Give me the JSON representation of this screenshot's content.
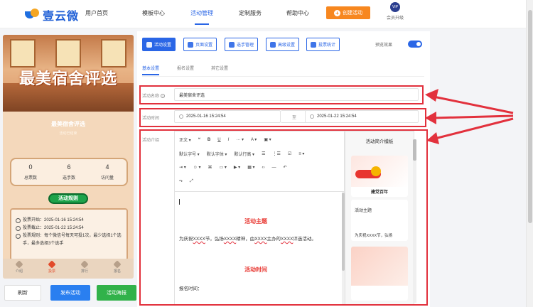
{
  "brand": {
    "name": "壹云微"
  },
  "nav": [
    {
      "label": "用户首页"
    },
    {
      "label": "模板中心"
    },
    {
      "label": "活动管理"
    },
    {
      "label": "定制服务"
    },
    {
      "label": "帮助中心"
    }
  ],
  "create_button": "创建活动",
  "vip": {
    "badge": "VIP",
    "label": "会员升级"
  },
  "preview": {
    "banner_title": "最美宿舍评选",
    "subtitle": "最美宿舍评选",
    "subtitle2": "活动已结束",
    "stats": [
      {
        "value": "0",
        "label": "总票数"
      },
      {
        "value": "6",
        "label": "选手数"
      },
      {
        "value": "4",
        "label": "访问量"
      }
    ],
    "rules_button": "活动规则",
    "rules": [
      "投票开始：2025-01-16 15:24:54",
      "投票截止：2025-01-22 15:24:54",
      "投票规则：每个微信号每天可投1次，最少选择1个选手，最多选择3个选手"
    ],
    "tabs": [
      "介绍",
      "投票",
      "排行",
      "报名"
    ]
  },
  "bottom_buttons": {
    "refresh": "刷新",
    "publish": "发布活动",
    "poster": "活动海报"
  },
  "toolbar": [
    {
      "label": "活动设置"
    },
    {
      "label": "页面设置"
    },
    {
      "label": "选手管理"
    },
    {
      "label": "高级设置"
    },
    {
      "label": "投票统计"
    }
  ],
  "preview_toggle_label": "预览效果",
  "subtabs": [
    "基本设置",
    "报名设置",
    "其它设置"
  ],
  "form": {
    "name_label": "活动名称",
    "name_value": "最美宿舍评选",
    "time_label": "活动时间",
    "start": "2025-01-16 15:24:54",
    "to": "至",
    "end": "2025-01-22 15:24:54",
    "intro_label": "活动介绍"
  },
  "editor": {
    "row1": [
      "正文 ▾",
      "❝",
      "B",
      "U",
      "I",
      "··· ▾",
      "A ▾",
      "▣ ▾"
    ],
    "row2": [
      "默认字号 ▾",
      "默认字体 ▾",
      "默认行高 ▾",
      "☰",
      "⋮☰",
      "☑",
      "≡ ▾"
    ],
    "row3": [
      "⇥ ▾",
      "☺ ▾",
      "⌘",
      "▭ ▾",
      "▶ ▾",
      "▦ ▾",
      "‹›",
      "—",
      "↶"
    ],
    "row4": [
      "↷",
      "⤢"
    ],
    "heading1": "活动主题",
    "para_pre": "为庆祝",
    "para_u1": "XXXX",
    "para_mid1": "节，弘扬",
    "para_u2": "XXXX",
    "para_mid2": "精神，由",
    "para_u3": "XXXX",
    "para_mid3": "主办的",
    "para_u4": "XXXX",
    "para_post": "评选活动。",
    "heading2": "活动时间",
    "para2": "报名时间："
  },
  "templates": {
    "title": "活动简介模板",
    "card1_caption": "建党百年",
    "card2_text": "活动主题",
    "card2_text2": "为庆祝XXXX节，弘扬"
  },
  "colors": {
    "accent": "#2a66e6",
    "highlight": "#e2313d",
    "orange": "#f7871f",
    "green": "#31b24a"
  }
}
